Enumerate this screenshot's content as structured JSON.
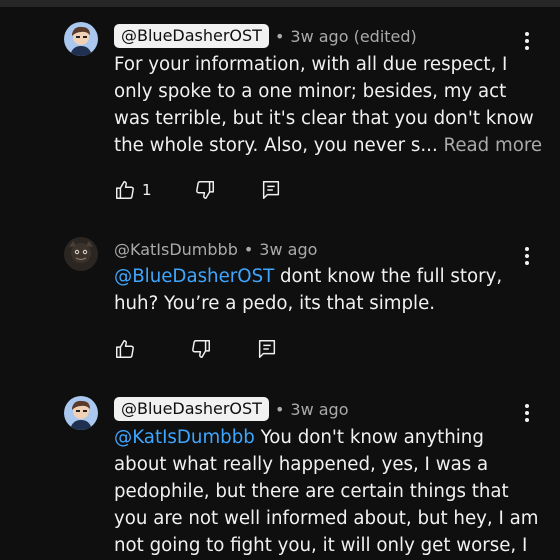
{
  "comments": [
    {
      "author": "@BlueDasherOST",
      "author_is_creator": true,
      "separator": "•",
      "time": "3w ago (edited)",
      "lines": [
        "For your information, with all due respect, I",
        "only spoke to a one minor; besides, my act",
        "was terrible, but it's clear that you don't know",
        "the whole story. Also, you never s..."
      ],
      "read_more": "Read more",
      "likes": "1"
    },
    {
      "author": "@KatIsDumbbb",
      "author_is_creator": false,
      "separator": "•",
      "time": "3w ago",
      "mention": "@BlueDasherOST",
      "line1_rest": " dont know the full story,",
      "lines": [
        "huh? You’re a pedo, its that simple."
      ],
      "likes": ""
    },
    {
      "author": "@BlueDasherOST",
      "author_is_creator": true,
      "separator": "•",
      "time": "3w ago",
      "mention": "@KatIsDumbbb",
      "line1_rest": " You don't know anything",
      "lines": [
        "about what really happened, yes, I was a",
        "pedophile, but there are certain things that",
        "you are not well informed about, but hey, I am",
        "not going to fight you, it will only get worse, I"
      ],
      "likes": ""
    }
  ],
  "icons": {
    "like": "thumbs-up-icon",
    "dislike": "thumbs-down-icon",
    "reply": "reply-icon",
    "menu": "more-vert-icon"
  },
  "colors": {
    "background": "#0f0f0f",
    "text": "#f1f1f1",
    "secondary": "#aaaaaa",
    "mention": "#3ea6ff",
    "creator_chip_bg": "#f1f1f1",
    "avatar_bg": "#a9c7ef"
  }
}
